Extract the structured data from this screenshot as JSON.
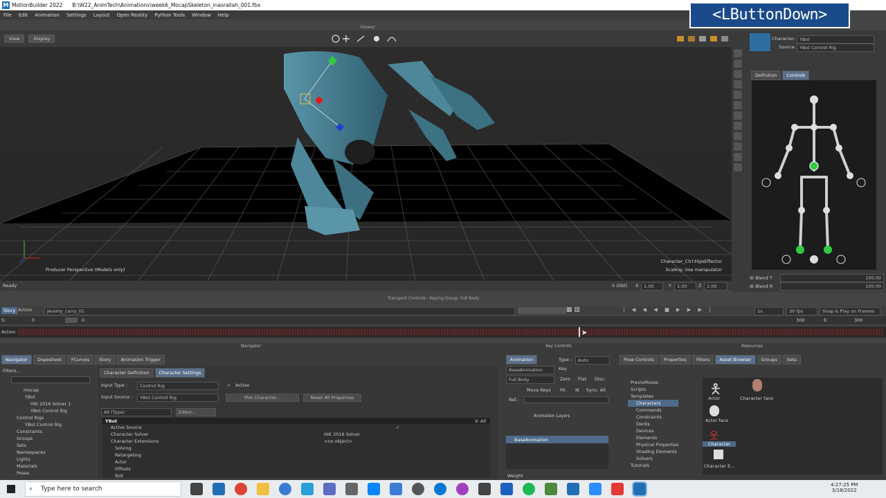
{
  "window": {
    "app_title": "MotionBuilder 2022",
    "file_path": "B:\\W22_AnimTech\\Animations\\week6_MocapSkeleton_inasrallah_001.fbx",
    "logo_letter": "M"
  },
  "menu": [
    "File",
    "Edit",
    "Animation",
    "Settings",
    "Layout",
    "Open Reality",
    "Python Tools",
    "Window",
    "Help"
  ],
  "overlay": {
    "event_text": "<LButtonDown>"
  },
  "viewer": {
    "label": "Viewer",
    "view_button": "View",
    "display_button": "Display",
    "camera_label": "Producer Perspective (Models only)",
    "selection_label": "Character_Ctrl:HipsEffector",
    "scaling_label": "Scaling: Use manipulator",
    "status": "Ready",
    "scale_label": "S (Gbl)",
    "scale_x_label": "X",
    "scale_x": "1.00",
    "scale_y_label": "Y",
    "scale_y": "1.00",
    "scale_z_label": "Z",
    "scale_z": "1.00"
  },
  "character_controls": {
    "character_label": "Character:",
    "character_value": "YBot",
    "source_label": "Source:",
    "source_value": "YBot Control Rig",
    "tabs": [
      "Definition",
      "Controls"
    ],
    "ik_blend_t_label": "IK Blend T",
    "ik_blend_t": "100.00",
    "ik_blend_r_label": "IK Blend R",
    "ik_blend_r": "100.00"
  },
  "transport": {
    "label": "Transport Controls  -  Keying Group: Full Body",
    "story_tab": "Story",
    "action_tab": "Action",
    "take_name": "Jeremy_carry_01",
    "speed": "1x",
    "fps": "30 fps",
    "snap_mode": "Snap & Play on Frames",
    "start_label": "S:",
    "start_value": "0",
    "current_value": "0",
    "end_value": "300",
    "end_label": "E:",
    "end_value2": "300",
    "action_label": "Action"
  },
  "navigator": {
    "header": "Navigator",
    "tabs": [
      "Navigator",
      "Dopesheet",
      "FCurves",
      "Story",
      "Animation Trigger"
    ],
    "filter_label": "Filters...",
    "tree": [
      "mocap",
      "YBot",
      "HIK 2016 Solver 1",
      "YBot Control Rig",
      "Control Rigs",
      "YBot Control Rig",
      "Constraints",
      "Groups",
      "Sets",
      "Namespaces",
      "Lights",
      "Materials",
      "Poses"
    ],
    "char_tabs": [
      "Character Definition",
      "Character Settings"
    ],
    "input_type_label": "Input Type :",
    "input_type_value": "Control Rig",
    "active_label": "Active",
    "input_source_label": "Input Source :",
    "input_source_value": "YBot Control Rig",
    "plot_button": "Plot Character...",
    "reset_button": "Reset All Properties",
    "type_filter": "All (Type)",
    "editor_button": "Editor...",
    "prop_root": "YBot",
    "prop_root_right": "V: All",
    "properties": [
      {
        "name": "Active Source",
        "value": ""
      },
      {
        "name": "Character Solver",
        "value": "HIK 2016 Solver"
      },
      {
        "name": "Character Extensions",
        "value": "<no object>"
      },
      {
        "name": "Solving",
        "value": ""
      },
      {
        "name": "Retargeting",
        "value": ""
      },
      {
        "name": "Actor",
        "value": ""
      },
      {
        "name": "Offsets",
        "value": ""
      },
      {
        "name": "Roll",
        "value": ""
      }
    ]
  },
  "key_controls": {
    "header": "Key Controls",
    "animation_tab": "Animation",
    "type_label": "Type :",
    "type_value": "Auto",
    "layer_value": "BaseAnimation",
    "key_button": "Key",
    "body_value": "Full Body",
    "zero_button": "Zero",
    "flat_button": "Flat",
    "disc_button": "Disc.",
    "move_keys": "Move Keys",
    "fk_button": "FK",
    "ik_button": "IK",
    "sync_button": "Sync. All",
    "ref_label": "Ref.:",
    "layers_header": "Animation Layers",
    "base_layer": "BaseAnimation",
    "weight_label": "Weight"
  },
  "resources": {
    "header": "Resources",
    "tabs": [
      "Pose Controls",
      "Properties",
      "Filters",
      "Asset Browser",
      "Groups",
      "Sets"
    ],
    "tree": [
      "PrevisMoves",
      "Scripts",
      "Templates",
      "Characters",
      "Commands",
      "Constraints",
      "Decks",
      "Devices",
      "Elements",
      "Physical Properties",
      "Shading Elements",
      "Solvers",
      "Tutorials"
    ],
    "assets": [
      "Actor",
      "Character face",
      "Actor face",
      "Character",
      "Character E..."
    ]
  },
  "taskbar": {
    "search_placeholder": "Type here to search",
    "time": "4:27:25 PM",
    "date": "3/18/2022"
  }
}
